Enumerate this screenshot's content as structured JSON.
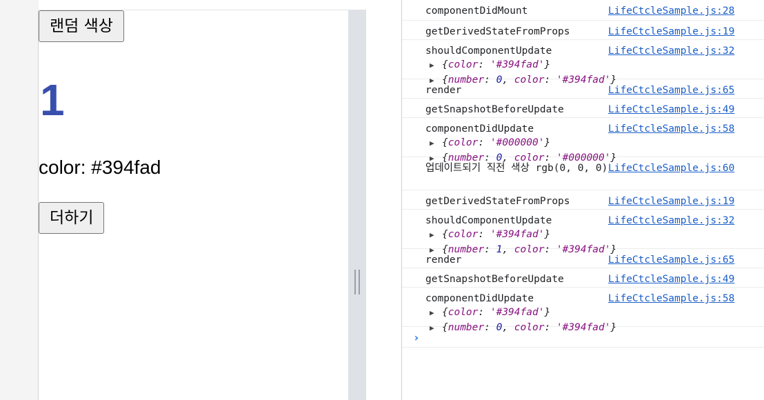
{
  "app": {
    "buttons": {
      "random_color": "랜덤 색상",
      "add": "더하기"
    },
    "counter": "1",
    "counter_color": "#394fad",
    "color_line": "color: #394fad"
  },
  "console": {
    "entries": [
      {
        "message": "componentDidMount",
        "source": "LifeCtcleSample.js:28"
      },
      {
        "message": "getDerivedStateFromProps",
        "source": "LifeCtcleSample.js:19"
      },
      {
        "message": "shouldComponentUpdate",
        "source": "LifeCtcleSample.js:32",
        "objects": [
          "{color: '#394fad'}",
          "{number: 0, color: '#394fad'}"
        ]
      },
      {
        "message": "render",
        "source": "LifeCtcleSample.js:65"
      },
      {
        "message": "getSnapshotBeforeUpdate",
        "source": "LifeCtcleSample.js:49"
      },
      {
        "message": "componentDidUpdate",
        "source": "LifeCtcleSample.js:58",
        "objects": [
          "{color: '#000000'}",
          "{number: 0, color: '#000000'}"
        ]
      },
      {
        "message": "업데이트되기 직전 색상 rgb(0, 0, 0)",
        "source": "LifeCtcleSample.js:60"
      },
      {
        "message": "getDerivedStateFromProps",
        "source": "LifeCtcleSample.js:19"
      },
      {
        "message": "shouldComponentUpdate",
        "source": "LifeCtcleSample.js:32",
        "objects": [
          "{color: '#394fad'}",
          "{number: 1, color: '#394fad'}"
        ]
      },
      {
        "message": "render",
        "source": "LifeCtcleSample.js:65"
      },
      {
        "message": "getSnapshotBeforeUpdate",
        "source": "LifeCtcleSample.js:49"
      },
      {
        "message": "componentDidUpdate",
        "source": "LifeCtcleSample.js:58",
        "objects": [
          "{color: '#394fad'}",
          "{number: 0, color: '#394fad'}"
        ]
      }
    ],
    "prompt_icon": "chevron-right-icon"
  }
}
